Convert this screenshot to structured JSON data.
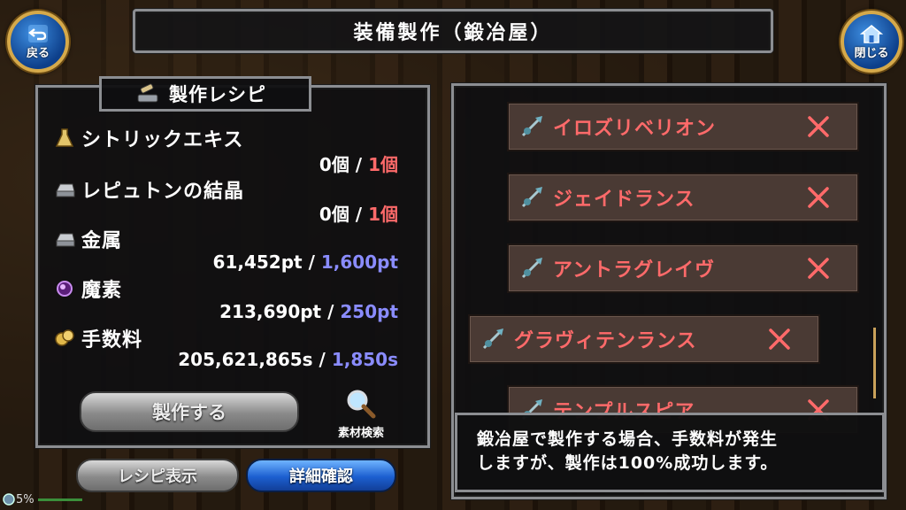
{
  "header": {
    "title": "装備製作（鍛冶屋）",
    "back_label": "戻る",
    "close_label": "閉じる"
  },
  "recipe": {
    "title": "製作レシピ",
    "materials": [
      {
        "name": "シトリックエキス",
        "have": "0個",
        "sep": "/",
        "need": "1個",
        "icon": "flask-icon"
      },
      {
        "name": "レピュトンの結晶",
        "have": "0個",
        "sep": "/",
        "need": "1個",
        "icon": "ingot-icon"
      },
      {
        "name": "金属",
        "have": "61,452pt",
        "sep": "/",
        "need": "1,600pt",
        "icon": "metal-icon"
      },
      {
        "name": "魔素",
        "have": "213,690pt",
        "sep": "/",
        "need": "250pt",
        "icon": "orb-icon"
      },
      {
        "name": "手数料",
        "have": "205,621,865s",
        "sep": "/",
        "need": "1,850s",
        "icon": "coin-icon"
      }
    ],
    "craft_label": "製作する",
    "search_label": "素材検索",
    "recipe_view_label": "レシピ表示",
    "details_label": "詳細確認"
  },
  "list": {
    "items": [
      {
        "name": "イロズリベリオン"
      },
      {
        "name": "ジェイドランス"
      },
      {
        "name": "アントラグレイヴ"
      },
      {
        "name": "グラヴィテンランス"
      },
      {
        "name": "テンプルスピア"
      }
    ]
  },
  "info": {
    "line1": "鍛冶屋で製作する場合、手数料が発生",
    "line2": "しますが、製作は100%成功します。"
  },
  "status": {
    "percent": "5%"
  },
  "colors": {
    "need_red": "#ff6a6a",
    "need_blue": "#8a8cff",
    "item_red": "#ff6a6a",
    "accent_blue": "#1c5fd0"
  }
}
